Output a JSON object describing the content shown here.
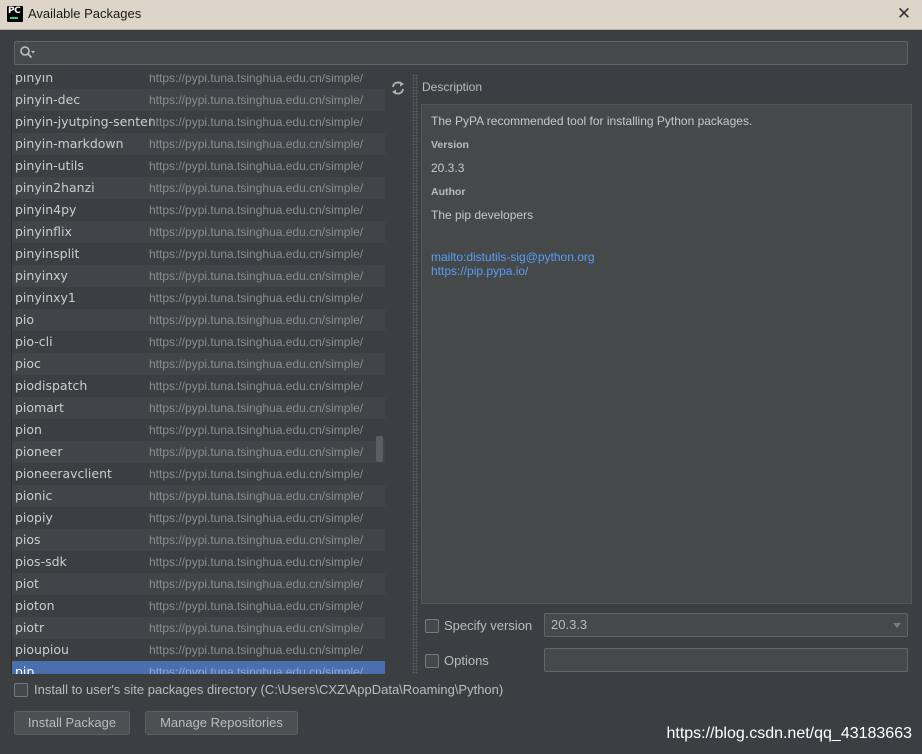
{
  "window": {
    "title": "Available Packages",
    "icon_text": "PC",
    "close": "✕"
  },
  "search": {
    "value": "",
    "placeholder": ""
  },
  "packages": [
    {
      "name": "pinyin",
      "repo": "https://pypi.tuna.tsinghua.edu.cn/simple/"
    },
    {
      "name": "pinyin-dec",
      "repo": "https://pypi.tuna.tsinghua.edu.cn/simple/"
    },
    {
      "name": "pinyin-jyutping-sentence",
      "repo": "https://pypi.tuna.tsinghua.edu.cn/simple/"
    },
    {
      "name": "pinyin-markdown",
      "repo": "https://pypi.tuna.tsinghua.edu.cn/simple/"
    },
    {
      "name": "pinyin-utils",
      "repo": "https://pypi.tuna.tsinghua.edu.cn/simple/"
    },
    {
      "name": "pinyin2hanzi",
      "repo": "https://pypi.tuna.tsinghua.edu.cn/simple/"
    },
    {
      "name": "pinyin4py",
      "repo": "https://pypi.tuna.tsinghua.edu.cn/simple/"
    },
    {
      "name": "pinyinflix",
      "repo": "https://pypi.tuna.tsinghua.edu.cn/simple/"
    },
    {
      "name": "pinyinsplit",
      "repo": "https://pypi.tuna.tsinghua.edu.cn/simple/"
    },
    {
      "name": "pinyinxy",
      "repo": "https://pypi.tuna.tsinghua.edu.cn/simple/"
    },
    {
      "name": "pinyinxy1",
      "repo": "https://pypi.tuna.tsinghua.edu.cn/simple/"
    },
    {
      "name": "pio",
      "repo": "https://pypi.tuna.tsinghua.edu.cn/simple/"
    },
    {
      "name": "pio-cli",
      "repo": "https://pypi.tuna.tsinghua.edu.cn/simple/"
    },
    {
      "name": "pioc",
      "repo": "https://pypi.tuna.tsinghua.edu.cn/simple/"
    },
    {
      "name": "piodispatch",
      "repo": "https://pypi.tuna.tsinghua.edu.cn/simple/"
    },
    {
      "name": "piomart",
      "repo": "https://pypi.tuna.tsinghua.edu.cn/simple/"
    },
    {
      "name": "pion",
      "repo": "https://pypi.tuna.tsinghua.edu.cn/simple/"
    },
    {
      "name": "pioneer",
      "repo": "https://pypi.tuna.tsinghua.edu.cn/simple/"
    },
    {
      "name": "pioneeravclient",
      "repo": "https://pypi.tuna.tsinghua.edu.cn/simple/"
    },
    {
      "name": "pionic",
      "repo": "https://pypi.tuna.tsinghua.edu.cn/simple/"
    },
    {
      "name": "piopiy",
      "repo": "https://pypi.tuna.tsinghua.edu.cn/simple/"
    },
    {
      "name": "pios",
      "repo": "https://pypi.tuna.tsinghua.edu.cn/simple/"
    },
    {
      "name": "pios-sdk",
      "repo": "https://pypi.tuna.tsinghua.edu.cn/simple/"
    },
    {
      "name": "piot",
      "repo": "https://pypi.tuna.tsinghua.edu.cn/simple/"
    },
    {
      "name": "pioton",
      "repo": "https://pypi.tuna.tsinghua.edu.cn/simple/"
    },
    {
      "name": "piotr",
      "repo": "https://pypi.tuna.tsinghua.edu.cn/simple/"
    },
    {
      "name": "pioupiou",
      "repo": "https://pypi.tuna.tsinghua.edu.cn/simple/"
    },
    {
      "name": "pip",
      "repo": "https://pypi.tuna.tsinghua.edu.cn/simple/",
      "selected": true
    }
  ],
  "description": {
    "label": "Description",
    "summary": "The PyPA recommended tool for installing Python packages.",
    "version_heading": "Version",
    "version": "20.3.3",
    "author_heading": "Author",
    "author": "The pip developers",
    "email_link": "mailto:distutils-sig@python.org",
    "home_link": "https://pip.pypa.io/"
  },
  "specify_version": {
    "label": "Specify version",
    "checked": false,
    "value": "20.3.3"
  },
  "options": {
    "label": "Options",
    "checked": false,
    "value": ""
  },
  "install_user": {
    "label": "Install to user's site packages directory (C:\\Users\\CXZ\\AppData\\Roaming\\Python)",
    "checked": false
  },
  "buttons": {
    "install": "Install Package",
    "manage": "Manage Repositories"
  },
  "watermark": "https://blog.csdn.net/qq_43183663",
  "icons": {
    "search": "search-icon",
    "refresh": "refresh-icon",
    "dropdown": "chevron-down-icon"
  },
  "colors": {
    "selection": "#4b6eaf",
    "link": "#589df6",
    "background": "#3c3f41"
  }
}
